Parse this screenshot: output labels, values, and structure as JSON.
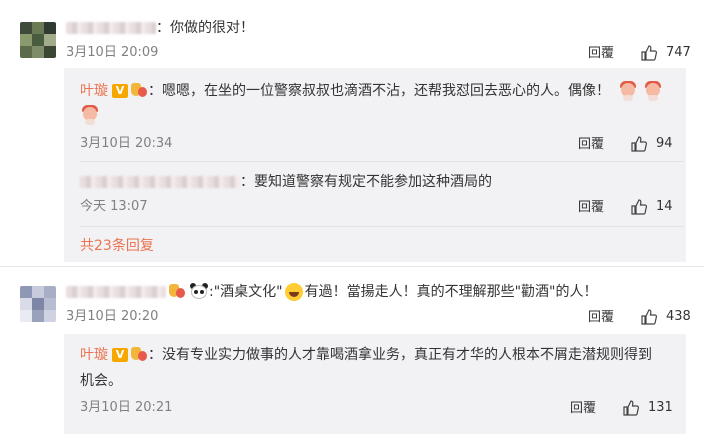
{
  "comments": [
    {
      "text": "：你做的很对！",
      "date": "3月10日 20:09",
      "reply_label": "回覆",
      "likes": "747"
    },
    {
      "text": ":\"酒桌文化\"",
      "text2": "有過！當揚走人！真的不理解那些\"勸酒\"的人！",
      "date": "3月10日 20:20",
      "reply_label": "回覆",
      "likes": "438"
    }
  ],
  "subs": [
    {
      "user": "叶璇",
      "text": "：嗯嗯，在坐的一位警察叔叔也滴酒不沾，还帮我怼回去恶心的人。偶像！",
      "date": "3月10日 20:34",
      "reply_label": "回覆",
      "likes": "94"
    },
    {
      "text": "：要知道警察有规定不能参加这种酒局的",
      "date": "今天 13:07",
      "reply_label": "回覆",
      "likes": "14"
    },
    {
      "user": "叶璇",
      "text": "：没有专业实力做事的人才靠喝酒拿业务，真正有才华的人根本不屑走潜规则得到",
      "text_line2": "机会。",
      "date": "3月10日 20:21",
      "reply_label": "回覆",
      "likes": "131"
    }
  ],
  "more_replies": "共23条回复",
  "vbadge": "V",
  "colors": {
    "accent": "#eb7350",
    "panel": "#f2f2f5",
    "muted": "#808080"
  },
  "icons": [
    "thumbs-up-icon",
    "verified-v-icon",
    "medal-icon",
    "emoji-face-icon",
    "panda-icon",
    "laugh-icon"
  ]
}
